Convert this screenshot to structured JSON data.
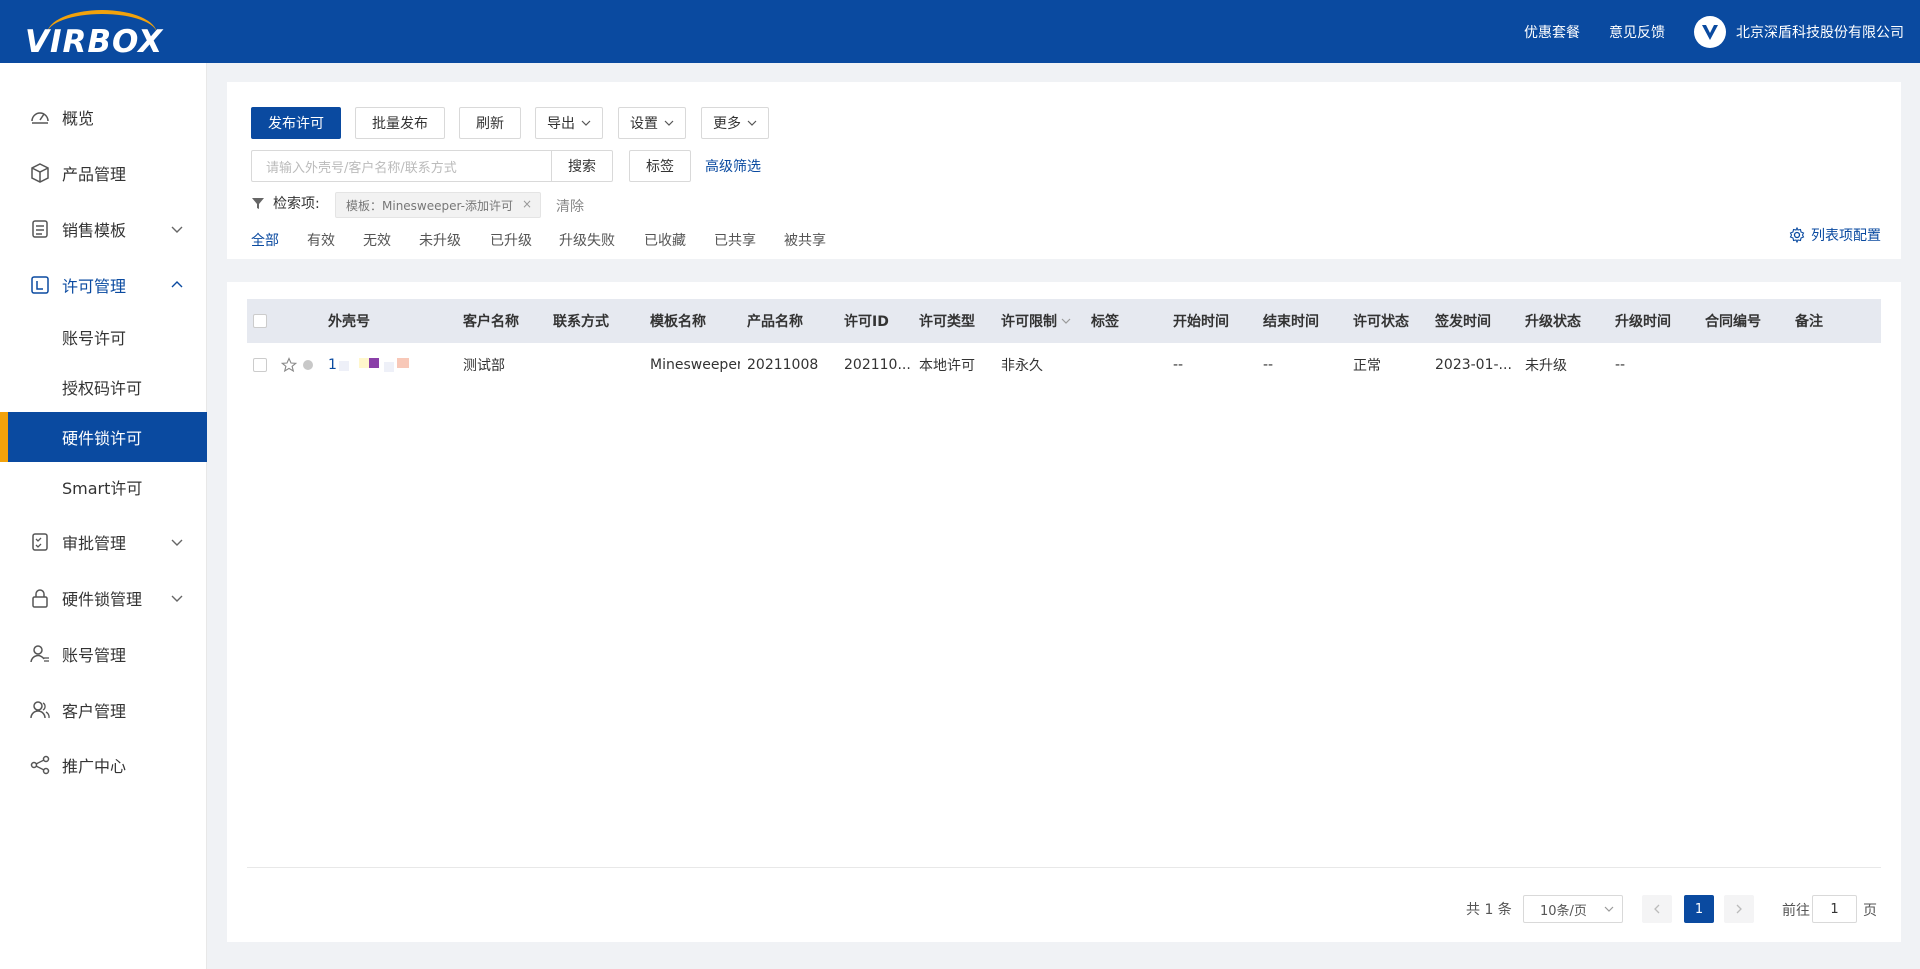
{
  "header": {
    "logo_text": "VIRBOX",
    "links": [
      "优惠套餐",
      "意见反馈"
    ],
    "company": "北京深盾科技股份有限公司"
  },
  "sidebar": {
    "items": [
      {
        "label": "概览",
        "icon": "dashboard-icon"
      },
      {
        "label": "产品管理",
        "icon": "box-icon"
      },
      {
        "label": "销售模板",
        "icon": "template-icon"
      },
      {
        "label": "许可管理",
        "icon": "license-icon"
      },
      {
        "label": "审批管理",
        "icon": "approval-icon"
      },
      {
        "label": "硬件锁管理",
        "icon": "lock-icon"
      },
      {
        "label": "账号管理",
        "icon": "user-icon"
      },
      {
        "label": "客户管理",
        "icon": "customers-icon"
      },
      {
        "label": "推广中心",
        "icon": "share-icon"
      }
    ],
    "sub_items": [
      "账号许可",
      "授权码许可",
      "硬件锁许可",
      "Smart许可"
    ],
    "active_sub": "硬件锁许可"
  },
  "toolbar": {
    "publish": "发布许可",
    "batch_publish": "批量发布",
    "refresh": "刷新",
    "export": "导出",
    "settings": "设置",
    "more": "更多",
    "search_placeholder": "请输入外壳号/客户名称/联系方式",
    "search": "搜索",
    "tags": "标签",
    "advanced": "高级筛选"
  },
  "filter": {
    "label": "检索项:",
    "chip": "模板：Minesweeper-添加许可",
    "clear": "清除"
  },
  "tabs": [
    "全部",
    "有效",
    "无效",
    "未升级",
    "已升级",
    "升级失败",
    "已收藏",
    "已共享",
    "被共享"
  ],
  "column_config": "列表项配置",
  "table": {
    "headers": [
      "外壳号",
      "客户名称",
      "联系方式",
      "模板名称",
      "产品名称",
      "许可ID",
      "许可类型",
      "许可限制",
      "标签",
      "开始时间",
      "结束时间",
      "许可状态",
      "签发时间",
      "升级状态",
      "升级时间",
      "合同编号",
      "备注"
    ],
    "rows": [
      {
        "shell_no": "1",
        "customer": "测试部",
        "contact": "",
        "template": "Minesweeper...",
        "product": "20211008",
        "license_id": "202110...",
        "license_type": "本地许可",
        "limit": "非永久",
        "tags": "",
        "start": "--",
        "end": "--",
        "status": "正常",
        "issued": "2023-01-...",
        "upgrade_status": "未升级",
        "upgrade_time": "--",
        "contract": "",
        "remark": ""
      }
    ]
  },
  "pagination": {
    "total": "共 1 条",
    "page_size": "10条/页",
    "current": "1",
    "goto_prefix": "前往",
    "goto_value": "1",
    "goto_suffix": "页"
  }
}
